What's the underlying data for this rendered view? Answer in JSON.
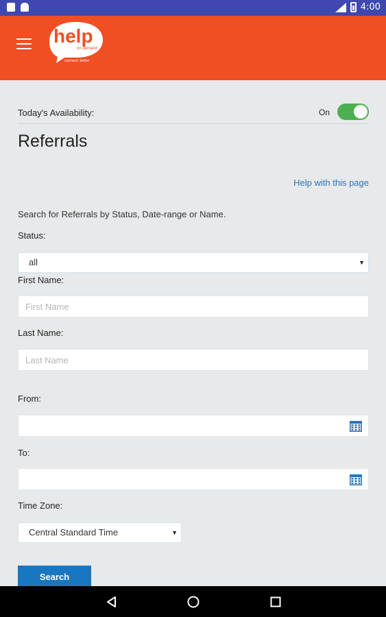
{
  "status_bar": {
    "time": "4:00"
  },
  "header": {
    "logo_word": "help",
    "logo_sub": "on demand",
    "logo_tagline": "connect. better",
    "bg_color": "#f04e23"
  },
  "availability": {
    "label": "Today's Availability:",
    "state": "On",
    "toggle_on": true,
    "toggle_color": "#4caf50"
  },
  "page": {
    "title": "Referrals",
    "help_link": "Help with this page",
    "intro": "Search for Referrals by Status, Date-range or Name."
  },
  "form": {
    "status_label": "Status:",
    "status_value": "all",
    "first_name_label": "First Name:",
    "first_name_placeholder": "First Name",
    "last_name_label": "Last Name:",
    "last_name_placeholder": "Last Name",
    "from_label": "From:",
    "to_label": "To:",
    "timezone_label": "Time Zone:",
    "timezone_value": "Central Standard Time",
    "search_label": "Search"
  },
  "icons": {
    "menu": "hamburger-menu-icon",
    "calendar": "calendar-icon",
    "back": "back-triangle-icon",
    "home": "home-circle-icon",
    "recents": "recents-square-icon"
  },
  "colors": {
    "link": "#2a74b8",
    "button": "#1976c0",
    "status_bar": "#3f48b0"
  }
}
